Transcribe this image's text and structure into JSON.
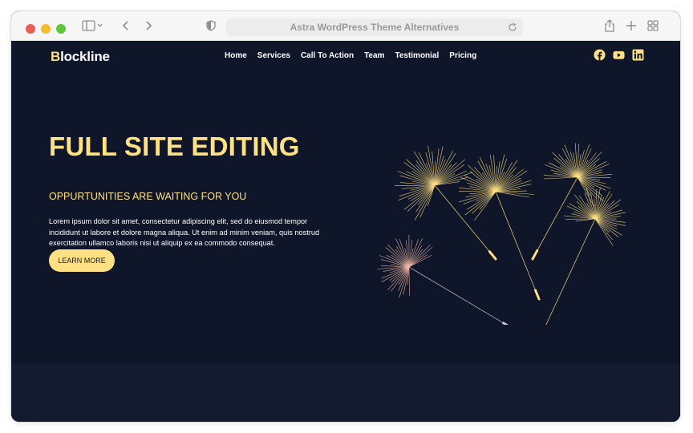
{
  "browser": {
    "page_title": "Astra WordPress Theme Alternatives"
  },
  "site": {
    "logo_first": "B",
    "logo_rest": "lockline",
    "nav": [
      "Home",
      "Services",
      "Call To Action",
      "Team",
      "Testimonial",
      "Pricing"
    ],
    "social_icons": [
      "facebook-icon",
      "youtube-icon",
      "linkedin-icon"
    ]
  },
  "hero": {
    "title": "FULL SITE EDITING",
    "subtitle": "OPPURTUNITIES ARE WAITING FOR YOU",
    "body": "Lorem ipsum dolor sit amet, consectetur adipiscing elit, sed do eiusmod tempor incididunt ut labore et dolore magna aliqua. Ut enim ad minim veniam, quis nostrud exercitation ullamco laboris nisi ut aliquip ex ea commodo consequat.",
    "cta_label": "LEARN MORE"
  },
  "colors": {
    "page_bg": "#0f1629",
    "accent": "#ffe083",
    "seed_pink": "#f3b9a6",
    "seed_lavender": "#c8c6e8"
  }
}
